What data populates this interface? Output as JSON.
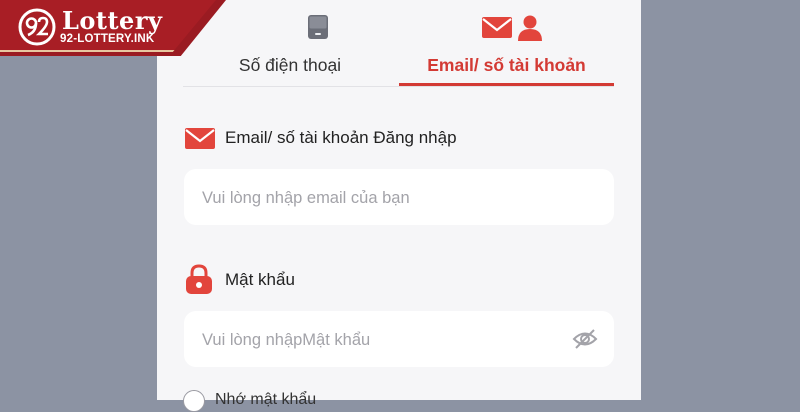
{
  "brand": {
    "title": "Lottery",
    "subtitle": "92-LOTTERY.INK",
    "colors": {
      "primary": "#a81e25",
      "accent": "#d33a34"
    }
  },
  "tabs": [
    {
      "label": "Số điện thoại",
      "icon": "phone-icon",
      "active": false
    },
    {
      "label": "Email/ số tài khoản",
      "icon": "email-user-icon",
      "active": true
    }
  ],
  "form": {
    "email": {
      "label": "Email/ số tài khoản Đăng nhập",
      "icon": "envelope-icon",
      "placeholder": "Vui lòng nhập email của bạn",
      "value": ""
    },
    "password": {
      "label": "Mật khẩu",
      "icon": "lock-icon",
      "placeholder": "Vui lòng nhậpMật khẩu",
      "value": "",
      "toggle_icon": "eye-off-icon"
    },
    "remember": {
      "label": "Nhớ mật khẩu",
      "checked": false
    }
  }
}
